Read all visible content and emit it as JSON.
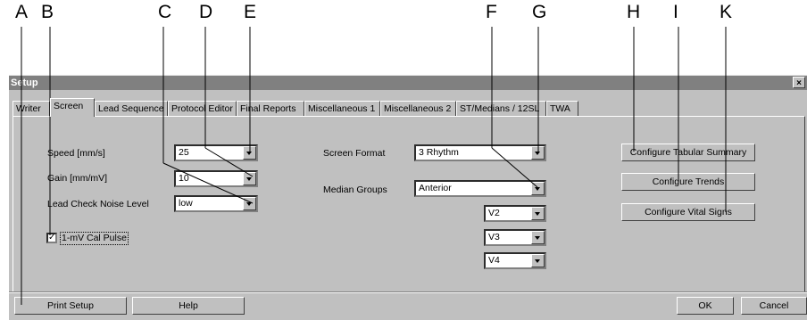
{
  "callouts": [
    "A",
    "B",
    "C",
    "D",
    "E",
    "F",
    "G",
    "H",
    "I",
    "K"
  ],
  "dialog": {
    "title": "Setup",
    "close": "×"
  },
  "tabs": [
    "Writer",
    "Screen",
    "Lead Sequence",
    "Protocol Editor",
    "Final Reports",
    "Miscellaneous 1",
    "Miscellaneous 2",
    "ST/Medians / 12SL",
    "TWA"
  ],
  "active_tab": "Screen",
  "left": {
    "speed_label": "Speed [mm/s]",
    "speed_value": "25",
    "gain_label": "Gain [mm/mV]",
    "gain_value": "10",
    "noise_label": "Lead Check Noise Level",
    "noise_value": "low",
    "cal_label": "1-mV Cal Pulse",
    "cal_checked": true
  },
  "middle": {
    "format_label": "Screen Format",
    "format_value": "3 Rhythm",
    "median_label": "Median Groups",
    "median_value": "Anterior",
    "leads": [
      "V2",
      "V3",
      "V4"
    ]
  },
  "right_buttons": [
    "Configure Tabular Summary",
    "Configure Trends",
    "Configure Vital Signs"
  ],
  "footer": {
    "print_setup": "Print Setup",
    "help": "Help",
    "ok": "OK",
    "cancel": "Cancel"
  }
}
